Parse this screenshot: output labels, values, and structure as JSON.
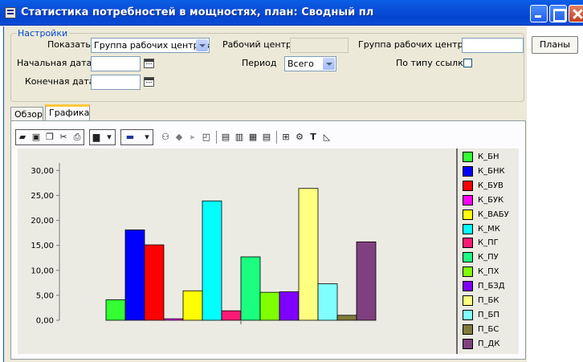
{
  "window": {
    "title": "Статистика потребностей в мощностях, план: Сводный пл"
  },
  "side": {
    "plans_button": "Планы"
  },
  "settings": {
    "legend": "Настройки",
    "show_by_label": "Показать по",
    "show_by_value": "Группа рабочих центров",
    "work_center_label": "Рабочий центр",
    "work_center_value": "",
    "work_center_group_label": "Группа рабочих центров",
    "work_center_group_value": "",
    "start_date_label": "Начальная дата",
    "start_date_value": "",
    "period_label": "Период",
    "period_value": "Всего",
    "by_link_type_label": "По типу ссылки",
    "by_link_type_checked": false,
    "end_date_label": "Конечная дата",
    "end_date_value": ""
  },
  "tabs": [
    {
      "label": "Обзор",
      "active": false
    },
    {
      "label": "Графика",
      "active": true
    }
  ],
  "toolbar": {
    "icons": [
      "open-icon",
      "save-icon",
      "copy-icon",
      "cut-icon",
      "print-icon",
      "bar-chart-icon",
      "dropdown-icon",
      "color-icon",
      "dropdown-icon",
      "binoculars-icon",
      "3d-icon",
      "cursor-icon",
      "zoom-icon",
      "page-icon",
      "page-active-icon",
      "grid-icon",
      "grid-lines-icon",
      "data-icon",
      "settings-icon",
      "text-icon",
      "axis-icon"
    ]
  },
  "chart_data": {
    "type": "bar",
    "title": "",
    "xlabel": "",
    "ylabel": "",
    "ylim": [
      0,
      30
    ],
    "y_ticks": [
      "0,00",
      "5,00",
      "10,00",
      "15,00",
      "20,00",
      "25,00",
      "30,00"
    ],
    "x_ticks": [
      ""
    ],
    "series": [
      {
        "name": "К_БН",
        "value": 4.1,
        "color": "#33ff33"
      },
      {
        "name": "К_БНК",
        "value": 18.1,
        "color": "#0000ff"
      },
      {
        "name": "К_БУВ",
        "value": 15.1,
        "color": "#ff0000"
      },
      {
        "name": "К_БУК",
        "value": 0.3,
        "color": "#ff00ff"
      },
      {
        "name": "К_ВАБУ",
        "value": 5.9,
        "color": "#ffff00"
      },
      {
        "name": "К_МК",
        "value": 23.9,
        "color": "#00ffff"
      },
      {
        "name": "К_ПГ",
        "value": 1.9,
        "color": "#ff1a75"
      },
      {
        "name": "К_ПУ",
        "value": 12.7,
        "color": "#1aff80"
      },
      {
        "name": "К_ПХ",
        "value": 5.6,
        "color": "#80ff00"
      },
      {
        "name": "П_БЗД",
        "value": 5.7,
        "color": "#8000ff"
      },
      {
        "name": "П_БК",
        "value": 26.4,
        "color": "#ffff80"
      },
      {
        "name": "П_БП",
        "value": 7.3,
        "color": "#80ffff"
      },
      {
        "name": "П_БС",
        "value": 1.0,
        "color": "#807a3c"
      },
      {
        "name": "П_ДК",
        "value": 15.7,
        "color": "#804080"
      }
    ]
  }
}
